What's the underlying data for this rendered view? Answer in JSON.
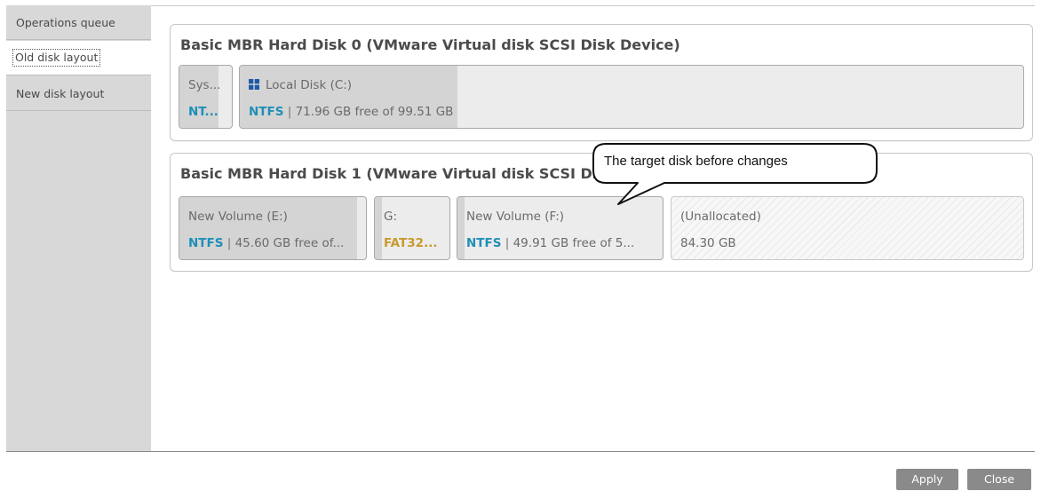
{
  "sidebar": {
    "items": [
      {
        "label": "Operations queue"
      },
      {
        "label": "Old disk layout"
      },
      {
        "label": "New disk layout"
      }
    ]
  },
  "disks": [
    {
      "title": "Basic MBR Hard Disk 0 (VMware Virtual disk SCSI Disk Device)",
      "partitions": [
        {
          "name": "Sys...",
          "fs": "NT...",
          "detail": ""
        },
        {
          "name": "Local Disk (C:)",
          "icon": "windows-icon",
          "fs": "NTFS",
          "sep": " | ",
          "detail": "71.96 GB free of 99.51 GB",
          "used_fraction": 0.277
        }
      ]
    },
    {
      "title": "Basic MBR Hard Disk 1 (VMware Virtual disk SCSI Disk Device)",
      "partitions": [
        {
          "name": "New Volume (E:)",
          "fs": "NTFS",
          "sep": " | ",
          "detail": "45.60 GB free of..."
        },
        {
          "name": "G:",
          "fs": "FAT32...",
          "detail": ""
        },
        {
          "name": "New Volume (F:)",
          "fs": "NTFS",
          "sep": " | ",
          "detail": "49.91 GB free of 5..."
        },
        {
          "name": "(Unallocated)",
          "detail": "84.30 GB"
        }
      ]
    }
  ],
  "callout": {
    "text": "The target disk before changes"
  },
  "buttons": {
    "apply": "Apply",
    "close": "Close"
  },
  "colors": {
    "ntfs": "#1f8fb8",
    "fat32": "#c79a2e",
    "button": "#8a8a8a",
    "sidebar": "#d8d8d8"
  }
}
